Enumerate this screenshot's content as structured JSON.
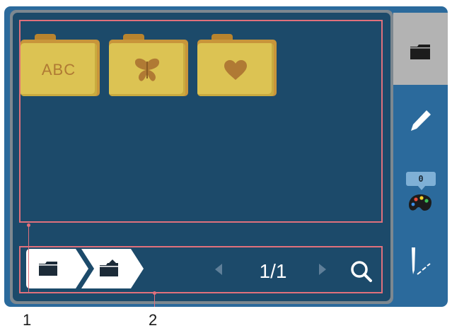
{
  "folders": [
    {
      "name": "folder-abc",
      "label": "ABC",
      "kind": "text"
    },
    {
      "name": "folder-butterfly",
      "icon": "butterfly-icon",
      "kind": "icon"
    },
    {
      "name": "folder-heart",
      "icon": "heart-icon",
      "kind": "icon"
    }
  ],
  "breadcrumb": [
    {
      "icon": "folder-icon"
    },
    {
      "icon": "folder-up-icon"
    }
  ],
  "pager": {
    "current": "1",
    "total": "1",
    "display": "1/1"
  },
  "sidebar": {
    "items": [
      {
        "icon": "folder-icon",
        "active": true
      },
      {
        "icon": "pencil-icon"
      },
      {
        "icon": "palette-icon",
        "badge": "0"
      },
      {
        "icon": "needle-stitch-icon"
      }
    ]
  },
  "callouts": {
    "area1": "1",
    "area2": "2"
  },
  "colors": {
    "screen": "#1c4a6a",
    "device": "#2b6a9c",
    "folder": "#dcc353",
    "folder_glyph": "#b07a34",
    "callout": "#e0707c",
    "sidebar_active": "#b3b3b3"
  }
}
